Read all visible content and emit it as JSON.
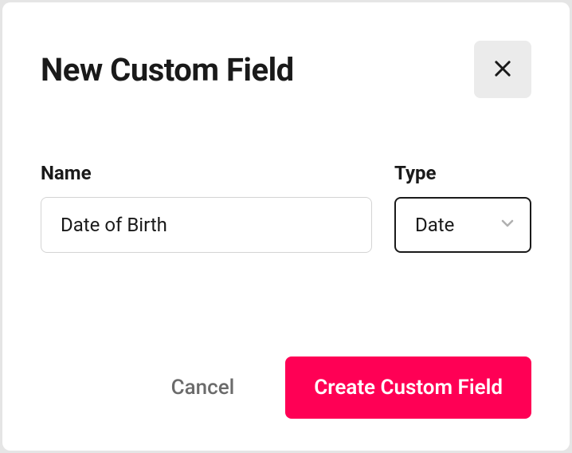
{
  "dialog": {
    "title": "New Custom Field",
    "fields": {
      "name": {
        "label": "Name",
        "value": "Date of Birth"
      },
      "type": {
        "label": "Type",
        "value": "Date"
      }
    },
    "actions": {
      "cancel": "Cancel",
      "submit": "Create Custom Field"
    }
  },
  "colors": {
    "primary": "#ff0055"
  }
}
